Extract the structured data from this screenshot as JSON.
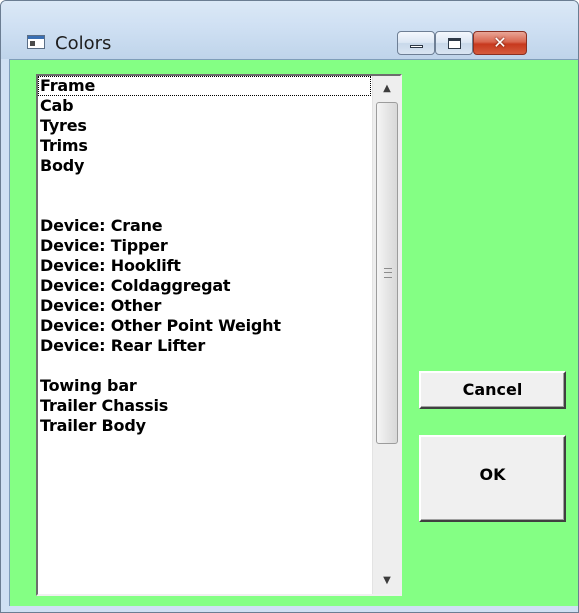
{
  "window": {
    "title": "Colors",
    "background_color": "#84ff84",
    "controls": {
      "minimize_icon": "minimize-icon",
      "maximize_icon": "maximize-icon",
      "close_icon": "close-icon",
      "close_glyph": "✕"
    }
  },
  "list": {
    "items": [
      "Frame",
      "Cab",
      "Tyres",
      "Trims",
      "Body",
      "",
      "",
      "Device: Crane",
      "Device: Tipper",
      "Device: Hooklift",
      "Device: Coldaggregat",
      "Device: Other",
      "Device: Other Point Weight",
      "Device: Rear Lifter",
      "",
      "Towing bar",
      "Trailer Chassis",
      "Trailer Body"
    ],
    "selected_index": 0,
    "scroll_up_glyph": "▲",
    "scroll_down_glyph": "▼"
  },
  "buttons": {
    "cancel_label": "Cancel",
    "ok_label": "OK"
  }
}
